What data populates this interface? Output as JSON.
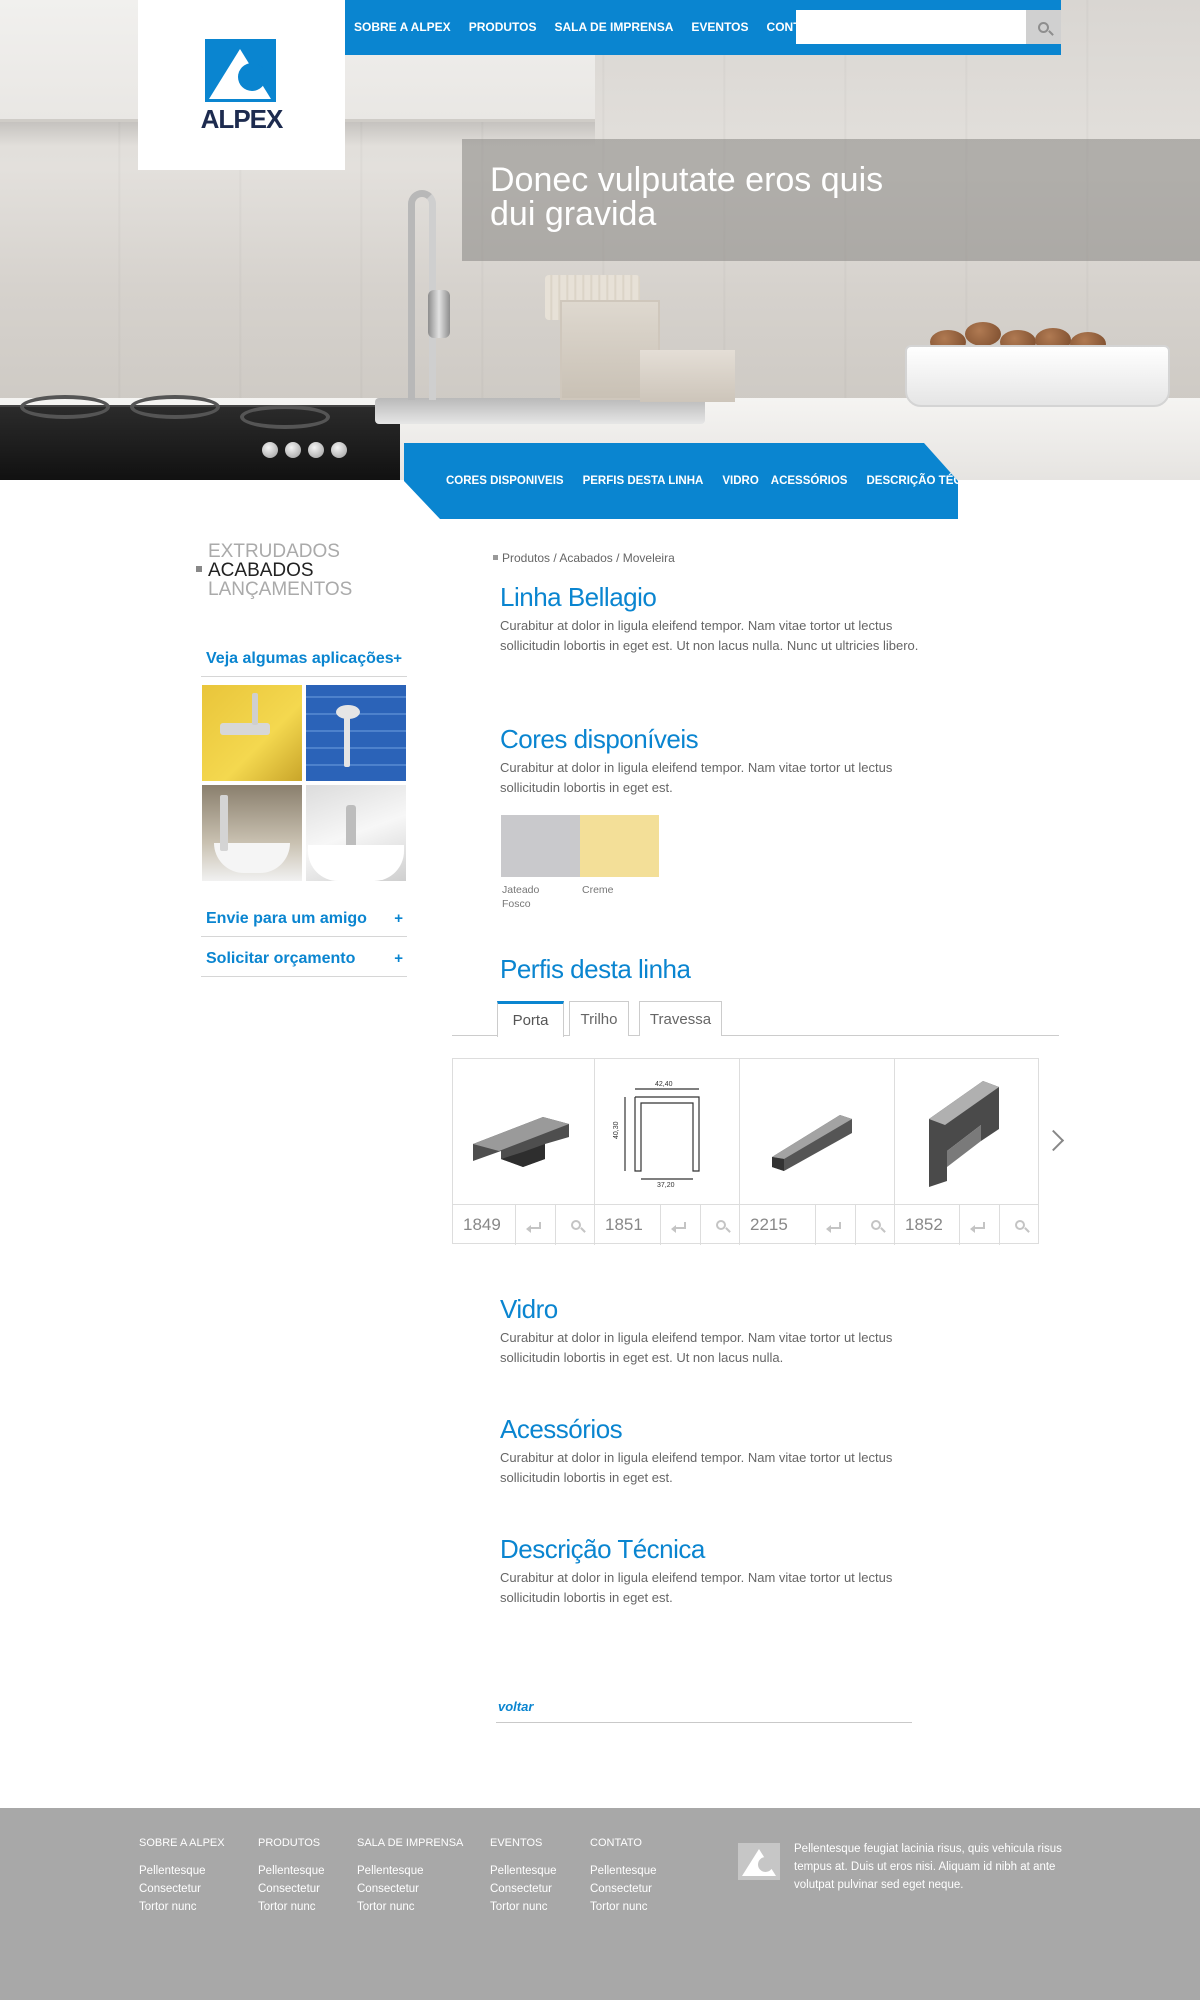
{
  "brand": {
    "logo_text": "ALPEX",
    "accent": "#0a85d0",
    "footer_bg": "#a8a8a8"
  },
  "topnav": {
    "items": [
      "SOBRE A ALPEX",
      "PRODUTOS",
      "SALA DE IMPRENSA",
      "EVENTOS",
      "CONTATO"
    ],
    "search_placeholder": ""
  },
  "hero": {
    "caption": "Donec vulputate eros quis dui gravida"
  },
  "subnav": {
    "items": [
      "CORES DISPONIVEIS",
      "PERFIS DESTA LINHA",
      "VIDRO",
      "ACESSÓRIOS",
      "DESCRIÇÃO TÉCNICA"
    ]
  },
  "sidebar": {
    "categories": [
      "EXTRUDADOS",
      "ACABADOS",
      "LANÇAMENTOS"
    ],
    "active_category": "ACABADOS",
    "applications_label": "Veja algumas aplicações",
    "send_friend_label": "Envie para um amigo",
    "quote_label": "Solicitar orçamento",
    "plus": "+"
  },
  "breadcrumb": "Produtos / Acabados / Moveleira",
  "sections": {
    "bellagio": {
      "title": "Linha Bellagio",
      "text": "Curabitur at dolor in ligula eleifend tempor. Nam vitae tortor ut lectus sollicitudin lobortis in eget est. Ut non lacus nulla. Nunc ut ultricies libero."
    },
    "cores": {
      "title": "Cores disponíveis",
      "text": "Curabitur at dolor in ligula eleifend tempor. Nam vitae tortor ut lectus sollicitudin lobortis in eget est."
    },
    "perfis": {
      "title": "Perfis desta linha"
    },
    "vidro": {
      "title": "Vidro",
      "text": "Curabitur at dolor in ligula eleifend tempor. Nam vitae tortor ut lectus sollicitudin lobortis in eget est. Ut non lacus nulla."
    },
    "acessorios": {
      "title": "Acessórios",
      "text": "Curabitur at dolor in ligula eleifend tempor. Nam vitae tortor ut lectus sollicitudin lobortis in eget est."
    },
    "descricao": {
      "title": "Descrição Técnica",
      "text": "Curabitur at dolor in ligula eleifend tempor. Nam vitae tortor ut lectus sollicitudin lobortis in eget est."
    }
  },
  "colors": [
    {
      "label": "Jateado Fosco",
      "hex": "#c9c9cc"
    },
    {
      "label": "Creme",
      "hex": "#f3df98"
    }
  ],
  "tabs": [
    "Porta",
    "Trilho",
    "Travessa"
  ],
  "profiles": [
    {
      "code": "1849"
    },
    {
      "code": "1851",
      "dims": [
        "42,40",
        "40,30",
        "37,20"
      ]
    },
    {
      "code": "2215"
    },
    {
      "code": "1852"
    }
  ],
  "voltar": "voltar",
  "footer": {
    "columns": [
      {
        "title": "SOBRE A ALPEX",
        "items": [
          "Pellentesque",
          "Consectetur",
          "Tortor nunc"
        ]
      },
      {
        "title": "PRODUTOS",
        "items": [
          "Pellentesque",
          "Consectetur",
          "Tortor nunc"
        ]
      },
      {
        "title": "SALA DE IMPRENSA",
        "items": [
          "Pellentesque",
          "Consectetur",
          "Tortor nunc"
        ]
      },
      {
        "title": "EVENTOS",
        "items": [
          "Pellentesque",
          "Consectetur",
          "Tortor nunc"
        ]
      },
      {
        "title": "CONTATO",
        "items": [
          "Pellentesque",
          "Consectetur",
          "Tortor nunc"
        ]
      }
    ],
    "text": "Pellentesque feugiat lacinia risus, quis vehicula risus tempus at. Duis ut eros nisi. Aliquam id nibh at ante volutpat pulvinar sed eget neque."
  }
}
